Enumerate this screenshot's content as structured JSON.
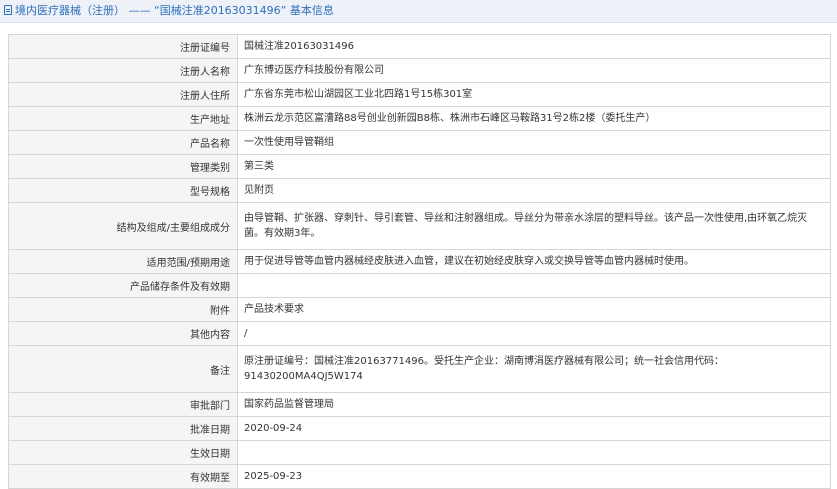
{
  "header": {
    "title": "境内医疗器械（注册） —— “国械注准20163031496” 基本信息",
    "icon": "document-icon"
  },
  "rows": [
    {
      "label": "注册证编号",
      "value": "国械注准20163031496"
    },
    {
      "label": "注册人名称",
      "value": "广东博迈医疗科技股份有限公司"
    },
    {
      "label": "注册人住所",
      "value": "广东省东莞市松山湖园区工业北四路1号15栋301室"
    },
    {
      "label": "生产地址",
      "value": "株洲云龙示范区富漕路88号创业创新园B8栋、株洲市石峰区马鞍路31号2栋2楼（委托生产）"
    },
    {
      "label": "产品名称",
      "value": "一次性使用导管鞘组"
    },
    {
      "label": "管理类别",
      "value": "第三类"
    },
    {
      "label": "型号规格",
      "value": "见附页"
    },
    {
      "label": "结构及组成/主要组成成分",
      "value": "由导管鞘、扩张器、穿刺针、导引套管、导丝和注射器组成。导丝分为带亲水涂层的塑料导丝。该产品一次性使用,由环氧乙烷灭菌。有效期3年。"
    },
    {
      "label": "适用范围/预期用途",
      "value": "用于促进导管等血管内器械经皮肤进入血管，建议在初始经皮肤穿入或交换导管等血管内器械时使用。"
    },
    {
      "label": "产品储存条件及有效期",
      "value": ""
    },
    {
      "label": "附件",
      "value": "产品技术要求"
    },
    {
      "label": "其他内容",
      "value": "/"
    },
    {
      "label": "备注",
      "value": "原注册证编号：国械注准20163771496。受托生产企业：湖南博涓医疗器械有限公司；统一社会信用代码：91430200MA4QJ5W174"
    },
    {
      "label": "审批部门",
      "value": "国家药品监督管理局"
    },
    {
      "label": "批准日期",
      "value": "2020-09-24"
    },
    {
      "label": "生效日期",
      "value": ""
    },
    {
      "label": "有效期至",
      "value": "2025-09-23"
    }
  ]
}
